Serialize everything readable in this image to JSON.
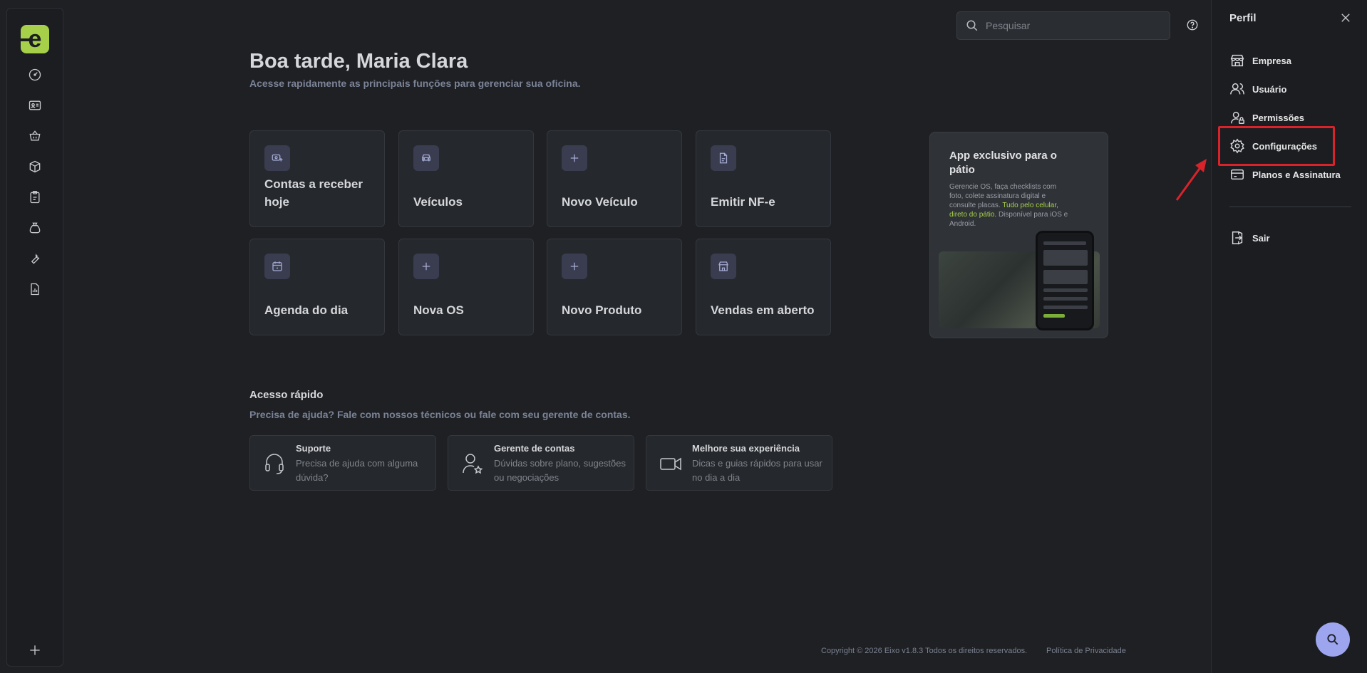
{
  "search": {
    "placeholder": "Pesquisar"
  },
  "greeting": {
    "title": "Boa tarde, Maria Clara",
    "subtitle": "Acesse rapidamente as principais funções para gerenciar sua oficina."
  },
  "shortcuts": [
    {
      "label": "Contas a receber hoje",
      "icon": "cash-icon"
    },
    {
      "label": "Veículos",
      "icon": "car-icon"
    },
    {
      "label": "Novo Veículo",
      "icon": "plus-icon"
    },
    {
      "label": "Emitir NF-e",
      "icon": "document-icon"
    },
    {
      "label": "Agenda do dia",
      "icon": "calendar-icon"
    },
    {
      "label": "Nova OS",
      "icon": "plus-icon"
    },
    {
      "label": "Novo Produto",
      "icon": "plus-icon"
    },
    {
      "label": "Vendas em aberto",
      "icon": "store-icon"
    }
  ],
  "promo": {
    "title": "App exclusivo para o pátio",
    "text_prefix": "Gerencie OS, faça checklists com foto, colete assinatura digital e consulte placas. ",
    "text_highlight": "Tudo pelo celular, direto do pátio.",
    "text_suffix": " Disponível para iOS e Android."
  },
  "quick_access": {
    "title": "Acesso rápido",
    "subtitle": "Precisa de ajuda? Fale com nossos técnicos ou fale com seu gerente de contas.",
    "cards": [
      {
        "title": "Suporte",
        "desc": "Precisa de ajuda com alguma dúvida?"
      },
      {
        "title": "Gerente de contas",
        "desc": "Dúvidas sobre plano, sugestões ou negociações"
      },
      {
        "title": "Melhore sua experiência",
        "desc": "Dicas e guias rápidos para usar no dia a dia"
      }
    ]
  },
  "footer": {
    "copyright": "Copyright © 2026 Eixo v1.8.3 Todos os direitos reservados.",
    "privacy": "Política de Privacidade"
  },
  "profile_panel": {
    "title": "Perfil",
    "items": [
      {
        "label": "Empresa",
        "icon": "store-icon"
      },
      {
        "label": "Usuário",
        "icon": "users-icon"
      },
      {
        "label": "Permissões",
        "icon": "user-lock-icon"
      },
      {
        "label": "Configurações",
        "icon": "gear-icon"
      },
      {
        "label": "Planos e Assinatura",
        "icon": "credit-card-icon"
      }
    ],
    "logout": "Sair"
  },
  "colors": {
    "accent": "#a6d04a",
    "background": "#1e2024",
    "highlight": "#d8232a",
    "fab": "#9ca5ee"
  }
}
